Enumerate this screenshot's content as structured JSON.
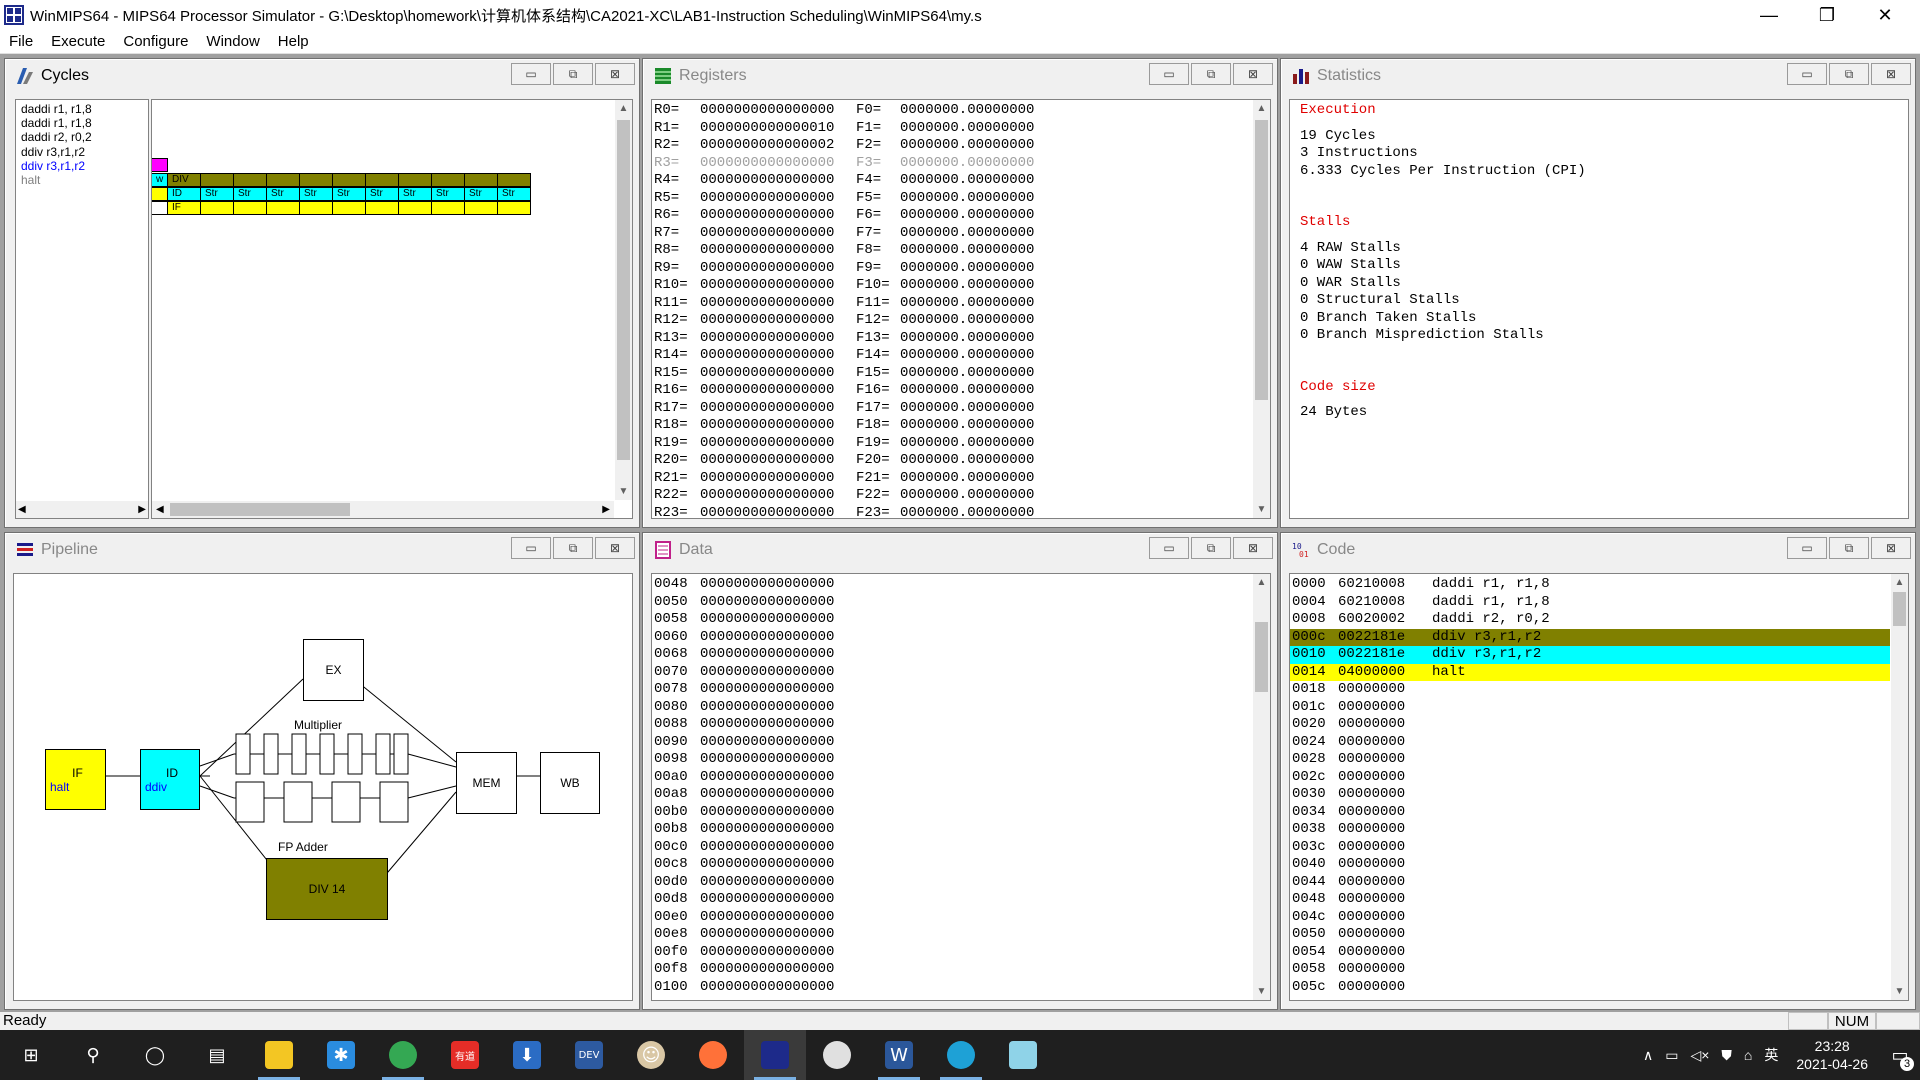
{
  "title": "WinMIPS64 - MIPS64 Processor Simulator - G:\\Desktop\\homework\\计算机体系结构\\CA2021-XC\\LAB1-Instruction Scheduling\\WinMIPS64\\my.s",
  "window_controls": {
    "minimize": "—",
    "restore": "❐",
    "close": "✕"
  },
  "menu": [
    "File",
    "Execute",
    "Configure",
    "Window",
    "Help"
  ],
  "cycles": {
    "title": "Cycles",
    "instructions": [
      {
        "text": "daddi r1, r1,8",
        "color": "#000000"
      },
      {
        "text": "daddi r1, r1,8",
        "color": "#000000"
      },
      {
        "text": "daddi r2, r0,2",
        "color": "#000000"
      },
      {
        "text": "ddiv r3,r1,r2",
        "color": "#000000"
      },
      {
        "text": "ddiv r3,r1,r2",
        "color": "#0000ff"
      },
      {
        "text": "halt",
        "color": "#808080"
      }
    ],
    "rows": [
      {
        "cells": []
      },
      {
        "cells": []
      },
      {
        "cells": [
          {
            "label": "",
            "color": "#ff00ff",
            "w": 16
          }
        ]
      },
      {
        "cells": [
          {
            "label": "w",
            "color": "#00ffff",
            "w": 16
          },
          {
            "label": "DIV",
            "color": "#808000",
            "w": 33
          },
          {
            "label": "",
            "color": "#808000",
            "w": 33
          },
          {
            "label": "",
            "color": "#808000",
            "w": 33
          },
          {
            "label": "",
            "color": "#808000",
            "w": 33
          },
          {
            "label": "",
            "color": "#808000",
            "w": 33
          },
          {
            "label": "",
            "color": "#808000",
            "w": 33
          },
          {
            "label": "",
            "color": "#808000",
            "w": 33
          },
          {
            "label": "",
            "color": "#808000",
            "w": 33
          },
          {
            "label": "",
            "color": "#808000",
            "w": 33
          },
          {
            "label": "",
            "color": "#808000",
            "w": 33
          },
          {
            "label": "",
            "color": "#808000",
            "w": 33
          }
        ]
      },
      {
        "cells": [
          {
            "label": "",
            "color": "#ffff00",
            "w": 16
          },
          {
            "label": "ID",
            "color": "#00ffff",
            "w": 33
          },
          {
            "label": "Str",
            "color": "#00ffff",
            "w": 33
          },
          {
            "label": "Str",
            "color": "#00ffff",
            "w": 33
          },
          {
            "label": "Str",
            "color": "#00ffff",
            "w": 33
          },
          {
            "label": "Str",
            "color": "#00ffff",
            "w": 33
          },
          {
            "label": "Str",
            "color": "#00ffff",
            "w": 33
          },
          {
            "label": "Str",
            "color": "#00ffff",
            "w": 33
          },
          {
            "label": "Str",
            "color": "#00ffff",
            "w": 33
          },
          {
            "label": "Str",
            "color": "#00ffff",
            "w": 33
          },
          {
            "label": "Str",
            "color": "#00ffff",
            "w": 33
          },
          {
            "label": "Str",
            "color": "#00ffff",
            "w": 33
          }
        ]
      },
      {
        "cells": [
          {
            "label": "",
            "color": "#ffffff",
            "w": 16
          },
          {
            "label": "IF",
            "color": "#ffff00",
            "w": 33
          },
          {
            "label": "",
            "color": "#ffff00",
            "w": 33
          },
          {
            "label": "",
            "color": "#ffff00",
            "w": 33
          },
          {
            "label": "",
            "color": "#ffff00",
            "w": 33
          },
          {
            "label": "",
            "color": "#ffff00",
            "w": 33
          },
          {
            "label": "",
            "color": "#ffff00",
            "w": 33
          },
          {
            "label": "",
            "color": "#ffff00",
            "w": 33
          },
          {
            "label": "",
            "color": "#ffff00",
            "w": 33
          },
          {
            "label": "",
            "color": "#ffff00",
            "w": 33
          },
          {
            "label": "",
            "color": "#ffff00",
            "w": 33
          },
          {
            "label": "",
            "color": "#ffff00",
            "w": 33
          }
        ]
      }
    ]
  },
  "registers": {
    "title": "Registers",
    "rows": [
      {
        "r": "R0=",
        "rv": "0000000000000000",
        "f": "F0=",
        "fv": "0000000.00000000",
        "dim": false
      },
      {
        "r": "R1=",
        "rv": "0000000000000010",
        "f": "F1=",
        "fv": "0000000.00000000",
        "dim": false
      },
      {
        "r": "R2=",
        "rv": "0000000000000002",
        "f": "F2=",
        "fv": "0000000.00000000",
        "dim": false
      },
      {
        "r": "R3=",
        "rv": "0000000000000000",
        "f": "F3=",
        "fv": "0000000.00000000",
        "dim": true
      },
      {
        "r": "R4=",
        "rv": "0000000000000000",
        "f": "F4=",
        "fv": "0000000.00000000",
        "dim": false
      },
      {
        "r": "R5=",
        "rv": "0000000000000000",
        "f": "F5=",
        "fv": "0000000.00000000",
        "dim": false
      },
      {
        "r": "R6=",
        "rv": "0000000000000000",
        "f": "F6=",
        "fv": "0000000.00000000",
        "dim": false
      },
      {
        "r": "R7=",
        "rv": "0000000000000000",
        "f": "F7=",
        "fv": "0000000.00000000",
        "dim": false
      },
      {
        "r": "R8=",
        "rv": "0000000000000000",
        "f": "F8=",
        "fv": "0000000.00000000",
        "dim": false
      },
      {
        "r": "R9=",
        "rv": "0000000000000000",
        "f": "F9=",
        "fv": "0000000.00000000",
        "dim": false
      },
      {
        "r": "R10=",
        "rv": "0000000000000000",
        "f": "F10=",
        "fv": "0000000.00000000",
        "dim": false
      },
      {
        "r": "R11=",
        "rv": "0000000000000000",
        "f": "F11=",
        "fv": "0000000.00000000",
        "dim": false
      },
      {
        "r": "R12=",
        "rv": "0000000000000000",
        "f": "F12=",
        "fv": "0000000.00000000",
        "dim": false
      },
      {
        "r": "R13=",
        "rv": "0000000000000000",
        "f": "F13=",
        "fv": "0000000.00000000",
        "dim": false
      },
      {
        "r": "R14=",
        "rv": "0000000000000000",
        "f": "F14=",
        "fv": "0000000.00000000",
        "dim": false
      },
      {
        "r": "R15=",
        "rv": "0000000000000000",
        "f": "F15=",
        "fv": "0000000.00000000",
        "dim": false
      },
      {
        "r": "R16=",
        "rv": "0000000000000000",
        "f": "F16=",
        "fv": "0000000.00000000",
        "dim": false
      },
      {
        "r": "R17=",
        "rv": "0000000000000000",
        "f": "F17=",
        "fv": "0000000.00000000",
        "dim": false
      },
      {
        "r": "R18=",
        "rv": "0000000000000000",
        "f": "F18=",
        "fv": "0000000.00000000",
        "dim": false
      },
      {
        "r": "R19=",
        "rv": "0000000000000000",
        "f": "F19=",
        "fv": "0000000.00000000",
        "dim": false
      },
      {
        "r": "R20=",
        "rv": "0000000000000000",
        "f": "F20=",
        "fv": "0000000.00000000",
        "dim": false
      },
      {
        "r": "R21=",
        "rv": "0000000000000000",
        "f": "F21=",
        "fv": "0000000.00000000",
        "dim": false
      },
      {
        "r": "R22=",
        "rv": "0000000000000000",
        "f": "F22=",
        "fv": "0000000.00000000",
        "dim": false
      },
      {
        "r": "R23=",
        "rv": "0000000000000000",
        "f": "F23=",
        "fv": "0000000.00000000",
        "dim": false
      }
    ]
  },
  "statistics": {
    "title": "Statistics",
    "execution_header": "Execution",
    "execution": [
      "19 Cycles",
      "3 Instructions",
      "6.333 Cycles Per Instruction (CPI)"
    ],
    "stalls_header": "Stalls",
    "stalls": [
      "4 RAW Stalls",
      "0 WAW Stalls",
      "0 WAR Stalls",
      "0 Structural Stalls",
      "0 Branch Taken Stalls",
      "0 Branch Misprediction Stalls"
    ],
    "codesize_header": "Code size",
    "codesize": "24 Bytes"
  },
  "pipeline": {
    "title": "Pipeline",
    "if_label": "IF",
    "if_instr": "halt",
    "id_label": "ID",
    "id_instr": "ddiv",
    "ex": "EX",
    "multiplier": "Multiplier",
    "fp_adder": "FP Adder",
    "div": "DIV 14",
    "mem": "MEM",
    "wb": "WB"
  },
  "data": {
    "title": "Data",
    "rows": [
      [
        "0048",
        "0000000000000000"
      ],
      [
        "0050",
        "0000000000000000"
      ],
      [
        "0058",
        "0000000000000000"
      ],
      [
        "0060",
        "0000000000000000"
      ],
      [
        "0068",
        "0000000000000000"
      ],
      [
        "0070",
        "0000000000000000"
      ],
      [
        "0078",
        "0000000000000000"
      ],
      [
        "0080",
        "0000000000000000"
      ],
      [
        "0088",
        "0000000000000000"
      ],
      [
        "0090",
        "0000000000000000"
      ],
      [
        "0098",
        "0000000000000000"
      ],
      [
        "00a0",
        "0000000000000000"
      ],
      [
        "00a8",
        "0000000000000000"
      ],
      [
        "00b0",
        "0000000000000000"
      ],
      [
        "00b8",
        "0000000000000000"
      ],
      [
        "00c0",
        "0000000000000000"
      ],
      [
        "00c8",
        "0000000000000000"
      ],
      [
        "00d0",
        "0000000000000000"
      ],
      [
        "00d8",
        "0000000000000000"
      ],
      [
        "00e0",
        "0000000000000000"
      ],
      [
        "00e8",
        "0000000000000000"
      ],
      [
        "00f0",
        "0000000000000000"
      ],
      [
        "00f8",
        "0000000000000000"
      ],
      [
        "0100",
        "0000000000000000"
      ]
    ]
  },
  "code": {
    "title": "Code",
    "rows": [
      {
        "addr": "0000",
        "hex": "60210008",
        "asm": "daddi r1, r1,8",
        "bg": ""
      },
      {
        "addr": "0004",
        "hex": "60210008",
        "asm": "daddi r1, r1,8",
        "bg": ""
      },
      {
        "addr": "0008",
        "hex": "60020002",
        "asm": "daddi r2, r0,2",
        "bg": ""
      },
      {
        "addr": "000c",
        "hex": "0022181e",
        "asm": "ddiv r3,r1,r2",
        "bg": "#808000"
      },
      {
        "addr": "0010",
        "hex": "0022181e",
        "asm": "ddiv r3,r1,r2",
        "bg": "#00ffff"
      },
      {
        "addr": "0014",
        "hex": "04000000",
        "asm": "halt",
        "bg": "#ffff00"
      },
      {
        "addr": "0018",
        "hex": "00000000",
        "asm": "",
        "bg": ""
      },
      {
        "addr": "001c",
        "hex": "00000000",
        "asm": "",
        "bg": ""
      },
      {
        "addr": "0020",
        "hex": "00000000",
        "asm": "",
        "bg": ""
      },
      {
        "addr": "0024",
        "hex": "00000000",
        "asm": "",
        "bg": ""
      },
      {
        "addr": "0028",
        "hex": "00000000",
        "asm": "",
        "bg": ""
      },
      {
        "addr": "002c",
        "hex": "00000000",
        "asm": "",
        "bg": ""
      },
      {
        "addr": "0030",
        "hex": "00000000",
        "asm": "",
        "bg": ""
      },
      {
        "addr": "0034",
        "hex": "00000000",
        "asm": "",
        "bg": ""
      },
      {
        "addr": "0038",
        "hex": "00000000",
        "asm": "",
        "bg": ""
      },
      {
        "addr": "003c",
        "hex": "00000000",
        "asm": "",
        "bg": ""
      },
      {
        "addr": "0040",
        "hex": "00000000",
        "asm": "",
        "bg": ""
      },
      {
        "addr": "0044",
        "hex": "00000000",
        "asm": "",
        "bg": ""
      },
      {
        "addr": "0048",
        "hex": "00000000",
        "asm": "",
        "bg": ""
      },
      {
        "addr": "004c",
        "hex": "00000000",
        "asm": "",
        "bg": ""
      },
      {
        "addr": "0050",
        "hex": "00000000",
        "asm": "",
        "bg": ""
      },
      {
        "addr": "0054",
        "hex": "00000000",
        "asm": "",
        "bg": ""
      },
      {
        "addr": "0058",
        "hex": "00000000",
        "asm": "",
        "bg": ""
      },
      {
        "addr": "005c",
        "hex": "00000000",
        "asm": "",
        "bg": ""
      }
    ]
  },
  "child_buttons": {
    "minimize": "▭",
    "maximize": "⧉",
    "close": "⊠"
  },
  "scroll_arrows": {
    "up": "▲",
    "down": "▼",
    "left": "◀",
    "right": "▶"
  },
  "status": {
    "text": "Ready",
    "num": "NUM"
  },
  "taskbar": {
    "apps": [
      {
        "name": "start",
        "glyph": "⊞",
        "color": "#ffffff"
      },
      {
        "name": "search",
        "glyph": "⚲",
        "color": "#ffffff"
      },
      {
        "name": "cortana",
        "glyph": "◯",
        "color": "#ffffff"
      },
      {
        "name": "task-view",
        "glyph": "▤",
        "color": "#ffffff"
      },
      {
        "name": "file-explorer",
        "glyph": "",
        "color": "#f3c623"
      },
      {
        "name": "app-blue-star",
        "glyph": "✱",
        "color": "#2a8cdf"
      },
      {
        "name": "chrome",
        "glyph": "",
        "color": "#34a853"
      },
      {
        "name": "youdao",
        "glyph": "有道",
        "color": "#e52d27"
      },
      {
        "name": "downloader",
        "glyph": "⬇",
        "color": "#2b6cc4"
      },
      {
        "name": "dev-cpp",
        "glyph": "DEV",
        "color": "#2d5aa0"
      },
      {
        "name": "app-avatar",
        "glyph": "☺",
        "color": "#d9c7a5"
      },
      {
        "name": "firefox",
        "glyph": "",
        "color": "#ff7139"
      },
      {
        "name": "winmips64",
        "glyph": "",
        "color": "#1d2a8a"
      },
      {
        "name": "app-grad",
        "glyph": "",
        "color": "#e0e0e0"
      },
      {
        "name": "word",
        "glyph": "W",
        "color": "#2b579a"
      },
      {
        "name": "edge",
        "glyph": "",
        "color": "#1ea1d6"
      },
      {
        "name": "app-board",
        "glyph": "",
        "color": "#8fd3e8"
      }
    ],
    "tray": {
      "caret": "∧",
      "network": "▭",
      "volume": "◁×",
      "shield": "⛊",
      "wifi": "⌂",
      "ime": "英",
      "time": "23:28",
      "date": "2021-04-26",
      "notif": "3"
    }
  }
}
